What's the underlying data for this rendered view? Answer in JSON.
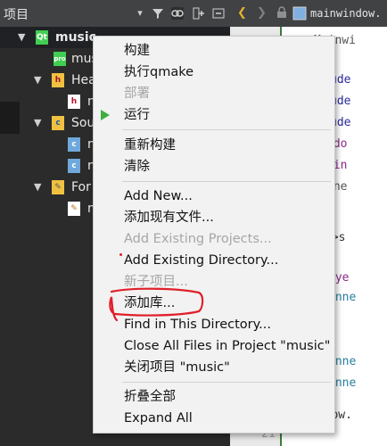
{
  "panel": {
    "title": "项目",
    "header_icons": [
      "filter-icon",
      "link-icon",
      "split-add-icon",
      "collapse-icon"
    ]
  },
  "tree": {
    "items": [
      {
        "label": "music",
        "icon": "qt-project-icon",
        "expanded": true
      },
      {
        "label": "mus",
        "icon": "pro-file-icon"
      },
      {
        "label": "Hea",
        "icon": "headers-folder-icon",
        "expanded": true
      },
      {
        "label": "m",
        "icon": "header-file-icon"
      },
      {
        "label": "Sou",
        "icon": "sources-folder-icon",
        "expanded": true
      },
      {
        "label": "m",
        "icon": "cpp-file-icon"
      },
      {
        "label": "m",
        "icon": "cpp-file-icon"
      },
      {
        "label": "For",
        "icon": "forms-folder-icon",
        "expanded": true
      },
      {
        "label": "m",
        "icon": "ui-file-icon"
      }
    ]
  },
  "editor": {
    "filename": "mainwindow.",
    "line_number": "21",
    "code_lines": [
      {
        "text": "Mainwi",
        "color": "#555555"
      },
      {
        "text": "ude",
        "color": "#2a2aa0"
      },
      {
        "text": "ude",
        "color": "#2a2aa0"
      },
      {
        "text": "ude",
        "color": "#2a2aa0"
      },
      {
        "text": "ndo",
        "color": "#8a2a8a"
      },
      {
        "text": "ain",
        "color": "#8a2a8a"
      },
      {
        "text": "(ne",
        "color": "#555555"
      },
      {
        "text": "->s",
        "color": "#333333"
      },
      {
        "text": "aye",
        "color": "#8a2a8a"
      },
      {
        "text": "onne",
        "color": "#2a7f9f"
      },
      {
        "text": "onne",
        "color": "#2a7f9f"
      },
      {
        "text": "onne",
        "color": "#2a7f9f"
      },
      {
        "text": "indow.",
        "color": "#333333"
      }
    ]
  },
  "menu": {
    "build": "构建",
    "run_qmake": "执行qmake",
    "deploy": "部署",
    "run": "运行",
    "rebuild": "重新构建",
    "clean": "清除",
    "add_new": "Add New...",
    "add_existing_files": "添加现有文件...",
    "add_existing_projects": "Add Existing Projects...",
    "add_existing_directory": "Add Existing Directory...",
    "new_subproject": "新子项目...",
    "add_library": "添加库...",
    "find_in_directory": "Find in This Directory...",
    "close_all_files": "Close All Files in Project \"music\"",
    "close_project": "关闭项目 \"music\"",
    "collapse_all": "折叠全部",
    "expand_all": "Expand All"
  },
  "colors": {
    "annotation_red": "#e0202a",
    "run_green": "#3fae3f",
    "panel_dark": "#2b2b2b",
    "toolbar": "#404244"
  }
}
